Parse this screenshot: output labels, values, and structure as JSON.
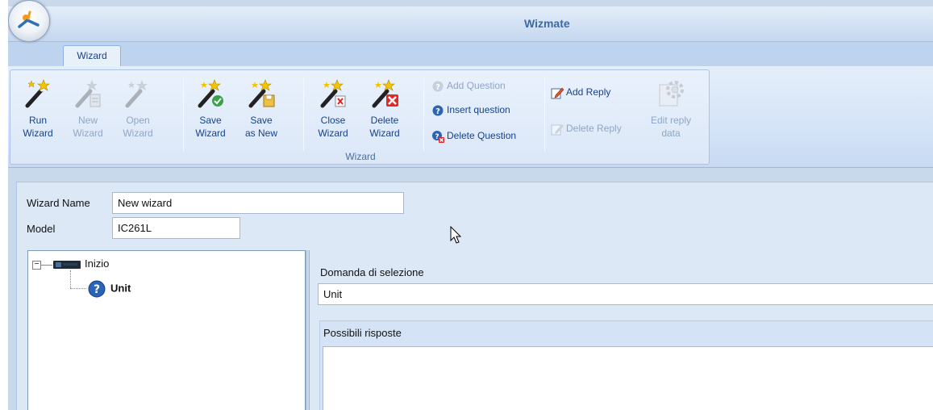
{
  "window": {
    "title": "Wizmate"
  },
  "tabs": [
    {
      "label": "Wizard",
      "active": true
    }
  ],
  "ribbon": {
    "group_label": "Wizard",
    "buttons": {
      "run": {
        "line1": "Run",
        "line2": "Wizard",
        "enabled": true,
        "icon": "magic-wand-icon"
      },
      "new": {
        "line1": "New",
        "line2": "Wizard",
        "enabled": false,
        "icon": "new-wizard-icon"
      },
      "open": {
        "line1": "Open",
        "line2": "Wizard",
        "enabled": false,
        "icon": "open-wizard-icon"
      },
      "save": {
        "line1": "Save",
        "line2": "Wizard",
        "enabled": true,
        "icon": "save-wizard-icon"
      },
      "save_as_new": {
        "line1": "Save",
        "line2": "as New",
        "enabled": true,
        "icon": "save-as-new-icon"
      },
      "close": {
        "line1": "Close",
        "line2": "Wizard",
        "enabled": true,
        "icon": "close-wizard-icon"
      },
      "delete": {
        "line1": "Delete",
        "line2": "Wizard",
        "enabled": true,
        "icon": "delete-wizard-icon"
      },
      "add_question": {
        "label": "Add Question",
        "enabled": false,
        "icon": "help-icon"
      },
      "insert_question": {
        "label": "Insert question",
        "enabled": true,
        "icon": "help-icon"
      },
      "delete_question": {
        "label": "Delete Question",
        "enabled": true,
        "icon": "delete-question-icon"
      },
      "add_reply": {
        "label": "Add Reply",
        "enabled": true,
        "icon": "edit-pencil-icon"
      },
      "delete_reply": {
        "label": "Delete Reply",
        "enabled": false,
        "icon": "delete-reply-icon"
      },
      "edit_reply_data": {
        "line1": "Edit reply",
        "line2": "data",
        "enabled": false,
        "icon": "gear-icon"
      }
    }
  },
  "form": {
    "wizard_name_label": "Wizard Name",
    "wizard_name_value": "New wizard",
    "model_label": "Model",
    "model_value": "IC261L"
  },
  "tree": {
    "root": {
      "label": "Inizio",
      "expander": "−",
      "icon": "device-icon"
    },
    "child": {
      "label": "Unit",
      "icon": "question-icon"
    }
  },
  "detail": {
    "question_label": "Domanda di selezione",
    "question_value": "Unit",
    "replies_label": "Possibili risposte"
  },
  "colors": {
    "ribbon_text": "#15428b",
    "disabled_text": "#8ea6c6",
    "panel_background": "#dce8f6"
  }
}
